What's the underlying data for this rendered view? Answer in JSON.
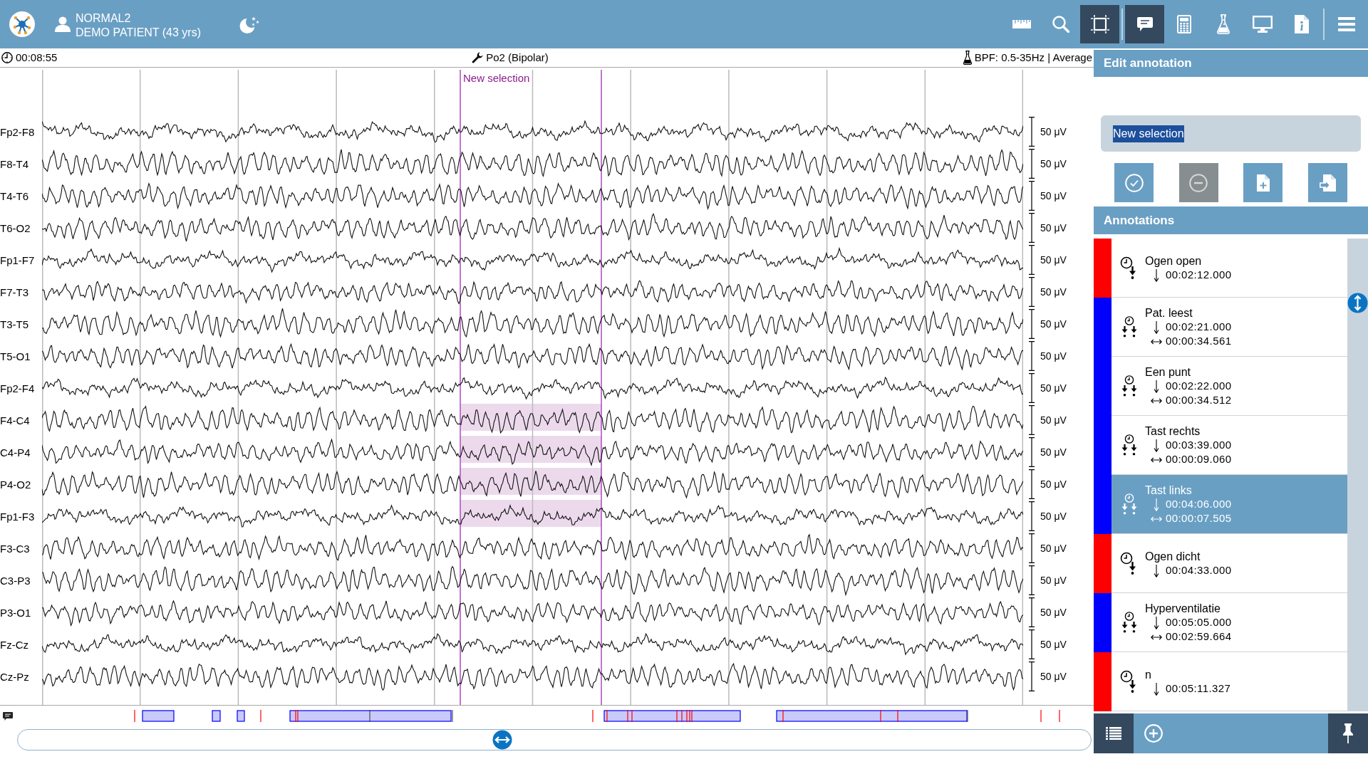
{
  "top_bar": {
    "patient": {
      "name": "NORMAL2",
      "details": "DEMO PATIENT (43 yrs)"
    },
    "toolbar_groups": [
      {
        "items": [
          {
            "kind": "ruler",
            "selected": false
          },
          {
            "kind": "search",
            "selected": false
          },
          {
            "kind": "crop",
            "selected": true
          }
        ]
      },
      {
        "items": [
          {
            "kind": "comment",
            "selected": true
          },
          {
            "kind": "calculator",
            "selected": false
          },
          {
            "kind": "flask",
            "selected": false
          },
          {
            "kind": "monitor",
            "selected": false
          },
          {
            "kind": "info",
            "selected": false
          }
        ]
      },
      {
        "items": [
          {
            "kind": "menu",
            "selected": false
          }
        ]
      }
    ]
  },
  "status_row": {
    "time": "00:08:55",
    "montage": "Po2 (Bipolar)",
    "filter": "BPF: 0.5-35Hz | Average"
  },
  "eeg": {
    "selection": {
      "label": "New selection"
    },
    "channels": [
      {
        "name": "Fp2-F8",
        "scale": "50 μV",
        "selected": false
      },
      {
        "name": "F8-T4",
        "scale": "50 μV",
        "selected": false
      },
      {
        "name": "T4-T6",
        "scale": "50 μV",
        "selected": false
      },
      {
        "name": "T6-O2",
        "scale": "50 μV",
        "selected": false
      },
      {
        "name": "Fp1-F7",
        "scale": "50 μV",
        "selected": false
      },
      {
        "name": "F7-T3",
        "scale": "50 μV",
        "selected": false
      },
      {
        "name": "T3-T5",
        "scale": "50 μV",
        "selected": false
      },
      {
        "name": "T5-O1",
        "scale": "50 μV",
        "selected": false
      },
      {
        "name": "Fp2-F4",
        "scale": "50 μV",
        "selected": false
      },
      {
        "name": "F4-C4",
        "scale": "50 μV",
        "selected": true
      },
      {
        "name": "C4-P4",
        "scale": "50 μV",
        "selected": true
      },
      {
        "name": "P4-O2",
        "scale": "50 μV",
        "selected": true
      },
      {
        "name": "Fp1-F3",
        "scale": "50 μV",
        "selected": true
      },
      {
        "name": "F3-C3",
        "scale": "50 μV",
        "selected": false
      },
      {
        "name": "C3-P3",
        "scale": "50 μV",
        "selected": false
      },
      {
        "name": "P3-O1",
        "scale": "50 μV",
        "selected": false
      },
      {
        "name": "Fz-Cz",
        "scale": "50 μV",
        "selected": false
      },
      {
        "name": "Cz-Pz",
        "scale": "50 μV",
        "selected": false
      }
    ]
  },
  "edit_annotation": {
    "title": "Edit annotation",
    "name_field": {
      "value": "New selection",
      "text_selected": true
    },
    "buttons": [
      {
        "kind": "confirm",
        "disabled": false
      },
      {
        "kind": "remove",
        "disabled": true
      },
      {
        "kind": "new",
        "disabled": false
      },
      {
        "kind": "import",
        "disabled": false
      }
    ]
  },
  "annotations": {
    "title": "Annotations",
    "items": [
      {
        "label": "Ogen open",
        "kind": "point",
        "color": "#ff0000",
        "onset": "00:02:12.000",
        "selected": false
      },
      {
        "label": "Pat. leest",
        "kind": "range",
        "color": "#0000ff",
        "onset": "00:02:21.000",
        "duration": "00:00:34.561",
        "selected": false
      },
      {
        "label": "Een punt",
        "kind": "range",
        "color": "#0000ff",
        "onset": "00:02:22.000",
        "duration": "00:00:34.512",
        "selected": false
      },
      {
        "label": "Tast rechts",
        "kind": "range",
        "color": "#0000ff",
        "onset": "00:03:39.000",
        "duration": "00:00:09.060",
        "selected": false
      },
      {
        "label": "Tast links",
        "kind": "range",
        "color": "#0000ff",
        "onset": "00:04:06.000",
        "duration": "00:00:07.505",
        "selected": true
      },
      {
        "label": "Ogen dicht",
        "kind": "point",
        "color": "#ff0000",
        "onset": "00:04:33.000",
        "selected": false
      },
      {
        "label": "Hyperventilatie",
        "kind": "range",
        "color": "#0000ff",
        "onset": "00:05:05.000",
        "duration": "00:02:59.664",
        "selected": false
      },
      {
        "label": "n",
        "kind": "point",
        "color": "#ff0000",
        "onset": "00:05:11.327",
        "selected": false
      }
    ]
  },
  "footer_toolbar": [
    {
      "kind": "list",
      "selected": true
    },
    {
      "kind": "add",
      "selected": false
    },
    {
      "kind": "pin",
      "selected": true
    }
  ]
}
